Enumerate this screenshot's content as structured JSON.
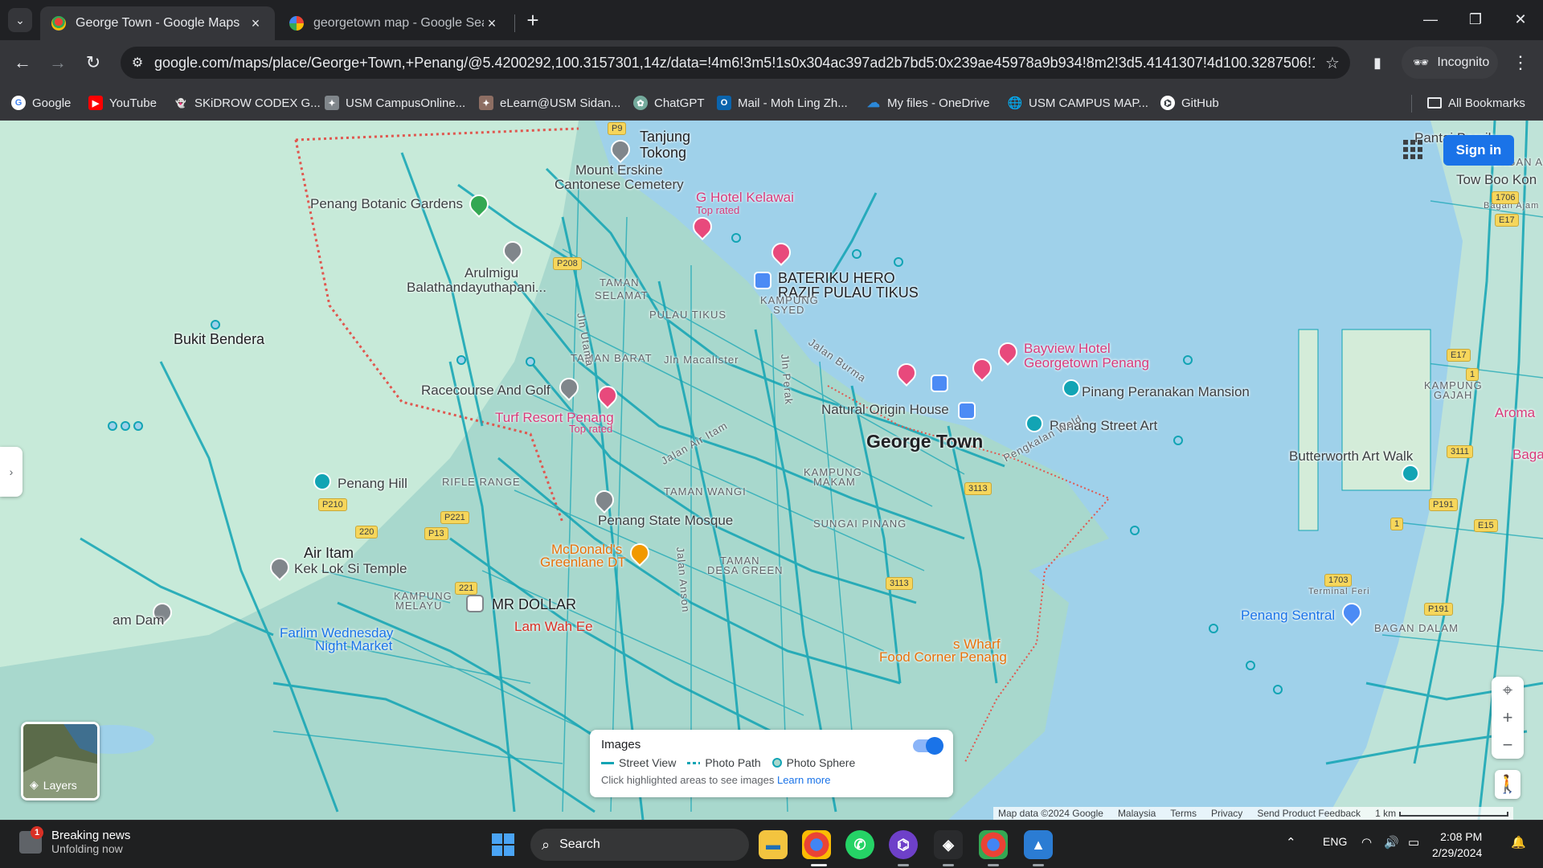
{
  "browser": {
    "tabs": [
      {
        "title": "George Town - Google Maps",
        "active": true,
        "icon": "google-maps-icon"
      },
      {
        "title": "georgetown map - Google Sear",
        "active": false,
        "icon": "google-icon"
      }
    ],
    "url": "google.com/maps/place/George+Town,+Penang/@5.4200292,100.3157301,14z/data=!4m6!3m5!1s0x304ac397ad2b7bd5:0x239ae45978a9b934!8m2!3d5.4141307!4d100.3287506!16zL2...",
    "incognito_label": "Incognito",
    "bookmarks": [
      {
        "label": "Google",
        "icon": "google-icon",
        "color": "#4285f4"
      },
      {
        "label": "YouTube",
        "icon": "youtube-icon",
        "color": "#ff0000"
      },
      {
        "label": "SKiDROW CODEX G...",
        "icon": "ghost-icon",
        "color": "#5f6368"
      },
      {
        "label": "USM CampusOnline...",
        "icon": "crest-icon",
        "color": "#80868b"
      },
      {
        "label": "eLearn@USM Sidan...",
        "icon": "crest-icon",
        "color": "#8d6e63"
      },
      {
        "label": "ChatGPT",
        "icon": "chatgpt-icon",
        "color": "#74aa9c"
      },
      {
        "label": "Mail - Moh Ling Zh...",
        "icon": "outlook-icon",
        "color": "#0a64ad"
      },
      {
        "label": "My files - OneDrive",
        "icon": "onedrive-icon",
        "color": "#0078d4"
      },
      {
        "label": "USM CAMPUS MAP...",
        "icon": "globe-icon",
        "color": "#5f6368"
      },
      {
        "label": "GitHub",
        "icon": "github-icon",
        "color": "#24292f"
      }
    ],
    "all_bookmarks": "All Bookmarks"
  },
  "map": {
    "sign_in": "Sign in",
    "layers_label": "Layers",
    "places": {
      "tanjung": "Tanjung",
      "tokong": "Tokong",
      "mount_erskine": "Mount Erskine",
      "cantonese_cemetery": "Cantonese Cemetery",
      "botanic": "Penang Botanic Gardens",
      "g_hotel": "G Hotel Kelawai",
      "top_rated_1": "Top rated",
      "arulmigu": "Arulmigu",
      "balathandayuthapani": "Balathandayuthapani...",
      "taman_selamat_1": "TAMAN",
      "taman_selamat_2": "SELAMAT",
      "bateriku_1": "BATERIKU HERO",
      "bateriku_2": "RAZIF PULAU TIKUS",
      "kampung_syed_1": "KAMPUNG",
      "kampung_syed_2": "SYED",
      "pulau_tikus": "PULAU TIKUS",
      "bukit_bendera": "Bukit Bendera",
      "taman_barat": "TAMAN BARAT",
      "racecourse": "Racecourse And Golf",
      "turf_resort": "Turf Resort Penang",
      "top_rated_2": "Top rated",
      "bayview_1": "Bayview Hotel",
      "bayview_2": "Georgetown Penang",
      "pinang_peranakan": "Pinang Peranakan Mansion",
      "natural_origin": "Natural Origin House",
      "george_town": "George Town",
      "penang_street_art": "Penang Street Art",
      "butterworth": "Butterworth Art Walk",
      "aroma": "Aroma",
      "penang_hill": "Penang Hill",
      "rifle_range": "RIFLE RANGE",
      "taman_wangi": "TAMAN WANGI",
      "kampung_makam_1": "KAMPUNG",
      "kampung_makam_2": "MAKAM",
      "penang_state_mosque": "Penang State Mosque",
      "sungai_pinang": "SUNGAI PINANG",
      "mcdonalds_1": "McDonald's",
      "mcdonalds_2": "Greenlane DT",
      "air_itam": "Air Itam",
      "kek_lok_si": "Kek Lok Si Temple",
      "taman_desa_green_1": "TAMAN",
      "taman_desa_green_2": "DESA GREEN",
      "kampung_melayu_1": "KAMPUNG",
      "kampung_melayu_2": "MELAYU",
      "mr_dollar": "MR DOLLAR",
      "lam_wah_ee": "Lam Wah Ee",
      "am_dam": "am Dam",
      "farlim_1": "Farlim Wednesday",
      "farlim_2": "Night Market",
      "wharf_1": "s Wharf",
      "wharf_2": "Food Corner Penang",
      "penang_sentral": "Penang Sentral",
      "bagan_dalam": "BAGAN DALAM",
      "terminal_feri": "Terminal Feri",
      "kampung_gajah_1": "KAMPUNG",
      "kampung_gajah_2": "GAJAH",
      "pantai_bersih": "Pantai Bersih",
      "bagan_a": "BAGAN A",
      "tow_boo_kong": "Tow Boo Kon",
      "bagan_ajam": "Bagan Ajam",
      "baga": "Baga",
      "jln_utama": "Jln Utama",
      "jln_macalister": "Jln Macalister",
      "jln_perak": "Jln Perak",
      "jln_burma": "Jalan Burma",
      "pengkalan_weld": "Pengkalan Weld",
      "jln_air_itam": "Jalan Air Itam",
      "jln_anson": "Jalan Anson"
    },
    "road_badges": [
      "P9",
      "P208",
      "P210",
      "P221",
      "P13",
      "220",
      "221",
      "3113",
      "3113",
      "1706",
      "E17",
      "E17",
      "1",
      "3111",
      "P191",
      "E15",
      "1",
      "1703",
      "P191"
    ],
    "images_panel": {
      "title": "Images",
      "street_view": "Street View",
      "photo_path": "Photo Path",
      "photo_sphere": "Photo Sphere",
      "hint": "Click highlighted areas to see images",
      "learn_more": "Learn more",
      "toggle_on": true
    },
    "attribution": {
      "map_data": "Map data ©2024 Google",
      "country": "Malaysia",
      "terms": "Terms",
      "privacy": "Privacy",
      "feedback": "Send Product Feedback",
      "scale": "1 km"
    }
  },
  "taskbar": {
    "news_badge": "1",
    "news_title": "Breaking news",
    "news_sub": "Unfolding now",
    "search": "Search",
    "language": "ENG",
    "time": "2:08 PM",
    "date": "2/29/2024"
  }
}
